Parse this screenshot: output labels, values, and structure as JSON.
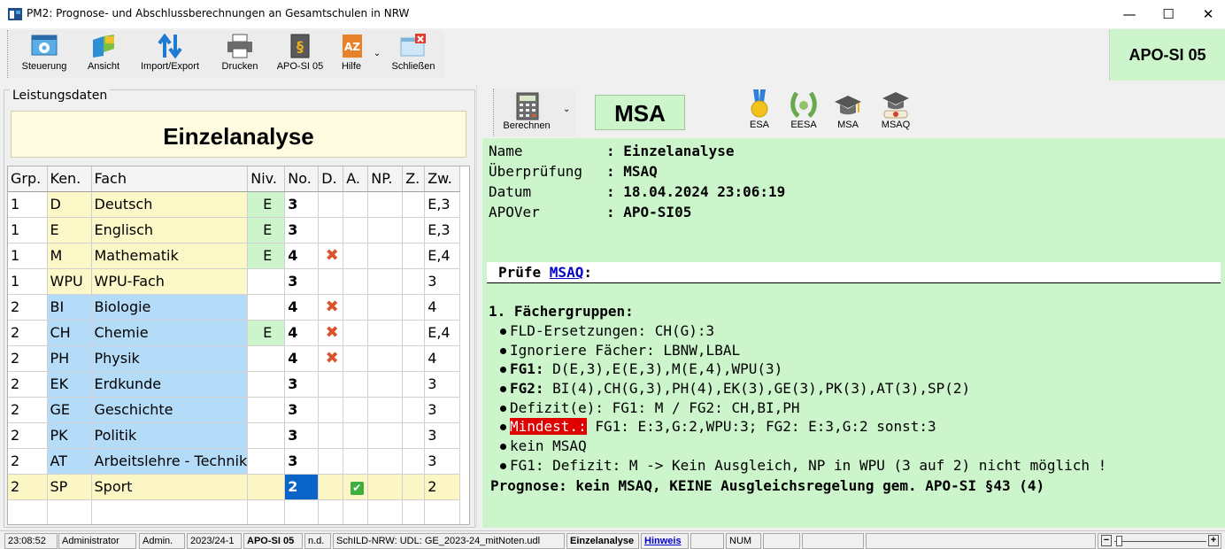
{
  "window": {
    "title": "PM2: Prognose- und Abschlussberechnungen an Gesamtschulen in NRW",
    "minimize": "—",
    "maximize": "☐",
    "close": "✕"
  },
  "toolbar": {
    "buttons": [
      {
        "label": "Steuerung",
        "icon": "settings-window-icon"
      },
      {
        "label": "Ansicht",
        "icon": "view-icon"
      },
      {
        "label": "Import/Export",
        "icon": "import-export-icon"
      },
      {
        "label": "Drucken",
        "icon": "printer-icon"
      },
      {
        "label": "APO-SI 05",
        "icon": "law-book-icon"
      },
      {
        "label": "Hilfe",
        "icon": "help-az-icon"
      },
      {
        "label": "Schließen",
        "icon": "close-window-icon"
      }
    ],
    "badge": "APO-SI 05"
  },
  "left": {
    "group_label": "Leistungsdaten",
    "heading": "Einzelanalyse",
    "columns": [
      "Grp.",
      "Ken.",
      "Fach",
      "Niv.",
      "No.",
      "D.",
      "A.",
      "NP.",
      "Z.",
      "Zw."
    ],
    "rows": [
      {
        "grp": "1",
        "ken": "D",
        "fach": "Deutsch",
        "niv": "E",
        "no": "3",
        "d": "",
        "a": "",
        "np": "",
        "z": "",
        "zw": "E,3",
        "color": "yellow"
      },
      {
        "grp": "1",
        "ken": "E",
        "fach": "Englisch",
        "niv": "E",
        "no": "3",
        "d": "",
        "a": "",
        "np": "",
        "z": "",
        "zw": "E,3",
        "color": "yellow"
      },
      {
        "grp": "1",
        "ken": "M",
        "fach": "Mathematik",
        "niv": "E",
        "no": "4",
        "d": "x",
        "a": "",
        "np": "",
        "z": "",
        "zw": "E,4",
        "color": "yellow"
      },
      {
        "grp": "1",
        "ken": "WPU",
        "fach": "WPU-Fach",
        "niv": "",
        "no": "3",
        "d": "",
        "a": "",
        "np": "",
        "z": "",
        "zw": "3",
        "color": "yellow"
      },
      {
        "grp": "2",
        "ken": "BI",
        "fach": "Biologie",
        "niv": "",
        "no": "4",
        "d": "x",
        "a": "",
        "np": "",
        "z": "",
        "zw": "4",
        "color": "blue"
      },
      {
        "grp": "2",
        "ken": "CH",
        "fach": "Chemie",
        "niv": "E",
        "no": "4",
        "d": "x",
        "a": "",
        "np": "",
        "z": "",
        "zw": "E,4",
        "color": "blue"
      },
      {
        "grp": "2",
        "ken": "PH",
        "fach": "Physik",
        "niv": "",
        "no": "4",
        "d": "x",
        "a": "",
        "np": "",
        "z": "",
        "zw": "4",
        "color": "blue"
      },
      {
        "grp": "2",
        "ken": "EK",
        "fach": "Erdkunde",
        "niv": "",
        "no": "3",
        "d": "",
        "a": "",
        "np": "",
        "z": "",
        "zw": "3",
        "color": "blue"
      },
      {
        "grp": "2",
        "ken": "GE",
        "fach": "Geschichte",
        "niv": "",
        "no": "3",
        "d": "",
        "a": "",
        "np": "",
        "z": "",
        "zw": "3",
        "color": "blue"
      },
      {
        "grp": "2",
        "ken": "PK",
        "fach": "Politik",
        "niv": "",
        "no": "3",
        "d": "",
        "a": "",
        "np": "",
        "z": "",
        "zw": "3",
        "color": "blue"
      },
      {
        "grp": "2",
        "ken": "AT",
        "fach": "Arbeitslehre - Technik",
        "niv": "",
        "no": "3",
        "d": "",
        "a": "",
        "np": "",
        "z": "",
        "zw": "3",
        "color": "blue"
      },
      {
        "grp": "2",
        "ken": "SP",
        "fach": "Sport",
        "niv": "",
        "no": "2",
        "d": "",
        "a": "check",
        "np": "",
        "z": "",
        "zw": "2",
        "color": "yellow2",
        "selected": true
      }
    ]
  },
  "right": {
    "calc_label": "Berechnen",
    "title": "MSA",
    "awards": [
      {
        "label": "ESA",
        "icon": "medal-icon"
      },
      {
        "label": "EESA",
        "icon": "laurel-icon"
      },
      {
        "label": "MSA",
        "icon": "graduation-cap-icon"
      },
      {
        "label": "MSAQ",
        "icon": "graduation-diploma-icon"
      }
    ],
    "meta": [
      {
        "key": "Name",
        "value": ": Einzelanalyse"
      },
      {
        "key": "Überprüfung",
        "value": ": MSAQ"
      },
      {
        "key": "Datum",
        "value": ": 18.04.2024 23:06:19"
      },
      {
        "key": "APOVer",
        "value": ": APO-SI05"
      }
    ],
    "pruefe_prefix": "Prüfe ",
    "pruefe_link": "MSAQ",
    "pruefe_suffix": ":",
    "section": "1. Fächergruppen:",
    "bullets": {
      "fld": "FLD-Ersetzungen: CH(G):3",
      "ignore": "Ignoriere Fächer: LBNW,LBAL",
      "fg1_label": "FG1:",
      "fg1_value": " D(E,3),E(E,3),M(E,4),WPU(3)",
      "fg2_label": "FG2:",
      "fg2_value": " BI(4),CH(G,3),PH(4),EK(3),GE(3),PK(3),AT(3),SP(2)",
      "defizit": "Defizit(e): FG1: M / FG2: CH,BI,PH",
      "mindest_label": "Mindest.:",
      "mindest_value": " FG1: E:3,G:2,WPU:3; FG2: E:3,G:2 sonst:3",
      "kein": "kein MSAQ",
      "fg1_defizit": "FG1: Defizit: M -> Kein Ausgleich, NP in WPU (3 auf 2) nicht möglich !"
    },
    "prognose": "Prognose: kein MSAQ, KEINE Ausgleichsregelung gem. APO-SI §43 (4)"
  },
  "statusbar": {
    "time": "23:08:52",
    "user": "Administrator",
    "role": "Admin.",
    "year": "2023/24-1",
    "apo": "APO-SI 05",
    "nd": "n.d.",
    "db": "SchILD-NRW: UDL: GE_2023-24_mitNoten.udl",
    "mode": "Einzelanalyse",
    "hint": "Hinweis",
    "num": "NUM",
    "zoom_minus": "−",
    "zoom_plus": "+"
  }
}
